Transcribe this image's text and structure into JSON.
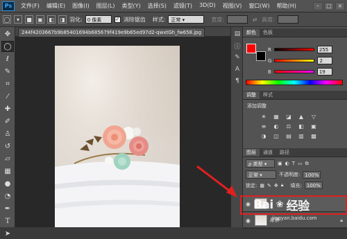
{
  "menubar": {
    "logo": "Ps",
    "items": [
      "文件(F)",
      "编辑(E)",
      "图像(I)",
      "图层(L)",
      "类型(Y)",
      "选择(S)",
      "滤镜(T)",
      "3D(D)",
      "视图(V)",
      "窗口(W)",
      "帮助(H)"
    ],
    "window_buttons": [
      "–",
      "□",
      "×"
    ]
  },
  "options_bar": {
    "feather_label": "羽化:",
    "feather_value": "0 像素",
    "antialias_label": "消除锯齿",
    "style_label": "样式:",
    "style_value": "正常",
    "width_label": "宽度:",
    "height_label": "高度:"
  },
  "document": {
    "tab_title": "244f4203667b9b85401694b685679f419e9b65ed97d2-qwxtGh_fw658.jpg"
  },
  "color_panel": {
    "tabs": [
      "颜色",
      "色板"
    ],
    "channels": [
      {
        "label": "R",
        "value": "255",
        "gradient": "linear-gradient(90deg,#000,#f00)"
      },
      {
        "label": "G",
        "value": "2",
        "gradient": "linear-gradient(90deg,#f00,#ff0)"
      },
      {
        "label": "B",
        "value": "19",
        "gradient": "linear-gradient(90deg,#f00,#f0f)"
      }
    ],
    "foreground": "#ff0000",
    "background": "#000000"
  },
  "adjustments_panel": {
    "tabs": [
      "调整",
      "样式"
    ],
    "title": "添加调整",
    "icons": [
      "☀",
      "▦",
      "◪",
      "▲",
      "▽",
      "≡",
      "◐",
      "⚖",
      "◧",
      "▣",
      "◑",
      "◫",
      "▤",
      "▥",
      "▩"
    ]
  },
  "layers_panel": {
    "tabs": [
      "图层",
      "通道",
      "路径"
    ],
    "kind_label": "ρ 类型",
    "blend_mode": "正常",
    "opacity_label": "不透明度:",
    "opacity_value": "100%",
    "lock_label": "锁定:",
    "fill_label": "填充:",
    "fill_value": "100%",
    "layers": [
      {
        "name": ""
      },
      {
        "name": "背景"
      }
    ]
  },
  "watermark": {
    "text": "Bai",
    "text2": "经验",
    "url": "jingyan.baidu.com"
  }
}
